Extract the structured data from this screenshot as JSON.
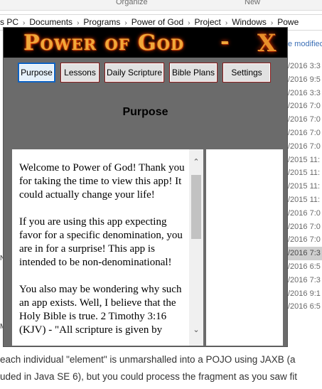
{
  "explorer": {
    "ribbon": [
      "Organize",
      "New"
    ],
    "breadcrumb": [
      "s PC",
      "Documents",
      "Programs",
      "Power of God",
      "Project",
      "Windows",
      "Powe"
    ],
    "column_header": "e modified",
    "dates": [
      "/2016 3:3",
      "/2016 9:5",
      "/2016 3:3",
      "/2016 7:0",
      "/2016 7:0",
      "/2016 7:0",
      "/2016 7:0",
      "/2015 11:",
      "/2015 11:",
      "/2015 11:",
      "/2015 11:",
      "/2016 7:0",
      "/2016 7:0",
      "/2016 7:0",
      "/2016 7:3",
      "/2016 6:5",
      "/2016 7:3",
      "/2016 9:1",
      "/2016 6:5"
    ],
    "left_fragments": [
      "N",
      "M"
    ],
    "bottom_text": [
      " each individual \"element\" is unmarshalled into a POJO using JAXB (a",
      "uded in Java SE 6), but you could process the fragment as you saw fit"
    ]
  },
  "app": {
    "title": "Power of God",
    "separator": "-",
    "close_label": "X",
    "nav": [
      "Purpose",
      "Lessons",
      "Daily Scripture",
      "Bible Plans",
      "Settings"
    ],
    "active_tab": "Purpose",
    "heading": "Purpose",
    "paragraphs": [
      "Welcome to Power of God! Thank you for taking the time to view this app! It could actually change your life!",
      "If you are using this app expecting favor for a specific denomination, you are in for a surprise! This app is intended to be non-denominational!",
      "You also may be wondering why such an app exists. Well, I believe that the Holy Bible is true. 2 Timothy 3:16 (KJV) - \"All scripture is given by"
    ],
    "scroll_up": "⌃",
    "scroll_down": "⌄"
  }
}
